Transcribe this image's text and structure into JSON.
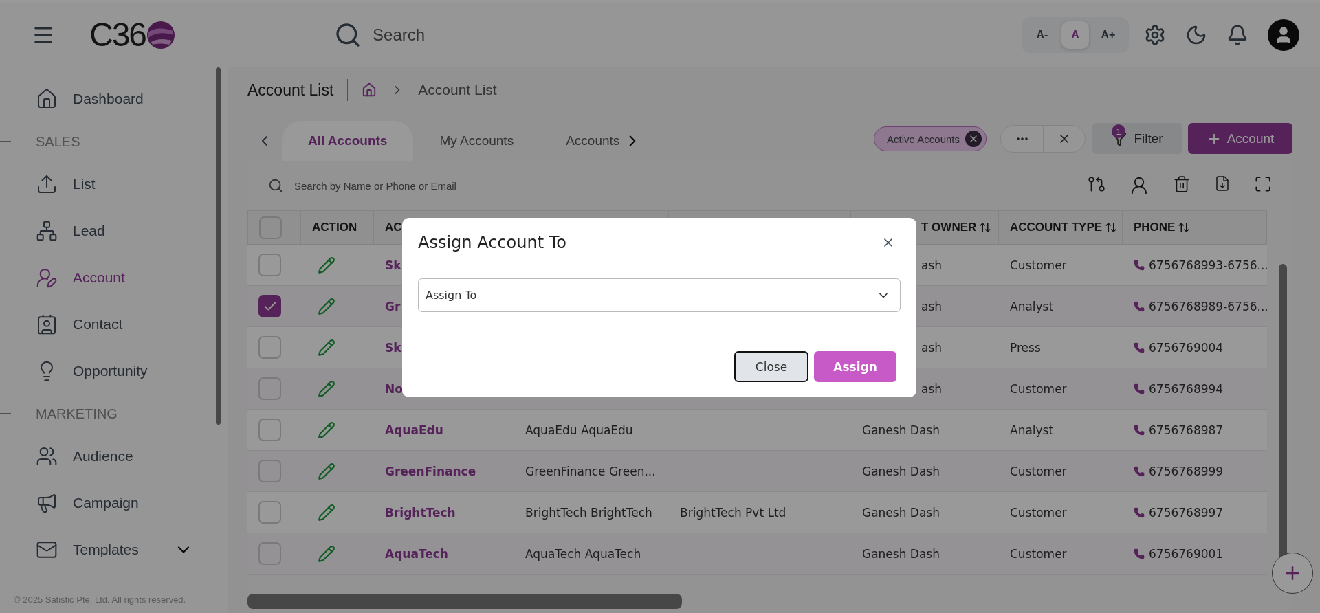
{
  "header": {
    "logo": "C36",
    "search": {
      "placeholder": "Search"
    },
    "font_sizes": [
      {
        "label": "A-",
        "selected": false
      },
      {
        "label": "A",
        "selected": true
      },
      {
        "label": "A+",
        "selected": false
      }
    ]
  },
  "sidebar": {
    "items": [
      {
        "kind": "link",
        "label": "Dashboard",
        "selected": false
      },
      {
        "kind": "section",
        "label": "SALES"
      },
      {
        "kind": "link",
        "label": "List",
        "selected": false
      },
      {
        "kind": "link",
        "label": "Lead",
        "selected": false
      },
      {
        "kind": "link",
        "label": "Account",
        "selected": true
      },
      {
        "kind": "link",
        "label": "Contact",
        "selected": false
      },
      {
        "kind": "link",
        "label": "Opportunity",
        "selected": false
      },
      {
        "kind": "section",
        "label": "MARKETING"
      },
      {
        "kind": "link",
        "label": "Audience",
        "selected": false
      },
      {
        "kind": "link",
        "label": "Campaign",
        "selected": false
      },
      {
        "kind": "group",
        "label": "Templates",
        "expanded": false
      }
    ],
    "footer": "© 2025 Satisfic Pte. Ltd. All rights reserved."
  },
  "page": {
    "title": "Account List",
    "breadcrumb": "Account List"
  },
  "tabs": [
    {
      "label": "All Accounts",
      "selected": true
    },
    {
      "label": "My Accounts",
      "selected": false
    },
    {
      "label": "Accounts",
      "selected": false
    }
  ],
  "active_filter": "Active Accounts",
  "filter_button": {
    "label": "Filter",
    "badge": "1"
  },
  "add_button": "Account",
  "table": {
    "search": {
      "placeholder": "Search by Name or Phone or Email"
    },
    "select_all": {
      "checked": false
    },
    "columns": [
      {
        "label": "ACTION",
        "sortable": false,
        "covered": false
      },
      {
        "label": "AC",
        "covered": false
      },
      {},
      {},
      {
        "label": "T OWNER",
        "sortable": true,
        "covered": true
      },
      {
        "label": "ACCOUNT TYPE",
        "sortable": true,
        "covered": false
      },
      {
        "label": "PHONE",
        "sortable": true,
        "covered": false
      }
    ],
    "rows": [
      {
        "checked": false,
        "covered": true,
        "name": "Sk",
        "owner": "ash",
        "type": "Customer",
        "phone": "6756768993-6756..."
      },
      {
        "checked": true,
        "covered": true,
        "name": "Gr",
        "owner": "ash",
        "type": "Analyst",
        "phone": "6756768989-6756..."
      },
      {
        "checked": false,
        "covered": true,
        "name": "Sk",
        "owner": "ash",
        "type": "Press",
        "phone": "6756769004"
      },
      {
        "checked": false,
        "covered": true,
        "name": "No",
        "owner": "ash",
        "type": "Customer",
        "phone": "6756768994"
      },
      {
        "checked": false,
        "covered": false,
        "name": "AquaEdu",
        "col_4": "AquaEdu AquaEdu",
        "owner": "Ganesh Dash",
        "type": "Analyst",
        "phone": "6756768987"
      },
      {
        "checked": false,
        "covered": false,
        "name": "GreenFinance",
        "col_4": "GreenFinance Green...",
        "owner": "Ganesh Dash",
        "type": "Customer",
        "phone": "6756768999"
      },
      {
        "checked": false,
        "covered": false,
        "name": "BrightTech",
        "col_4": "BrightTech BrightTech",
        "col_5": "BrightTech Pvt Ltd",
        "owner": "Ganesh Dash",
        "type": "Customer",
        "phone": "6756768997"
      },
      {
        "checked": false,
        "covered": false,
        "name": "AquaTech",
        "col_4": "AquaTech AquaTech",
        "owner": "Ganesh Dash",
        "type": "Customer",
        "phone": "6756769001"
      }
    ]
  },
  "dialog": {
    "title": "Assign Account To",
    "select": {
      "placeholder": "Assign To"
    },
    "buttons": [
      {
        "label": "Close",
        "kind": "secondary"
      },
      {
        "label": "Assign",
        "kind": "primary"
      }
    ]
  }
}
